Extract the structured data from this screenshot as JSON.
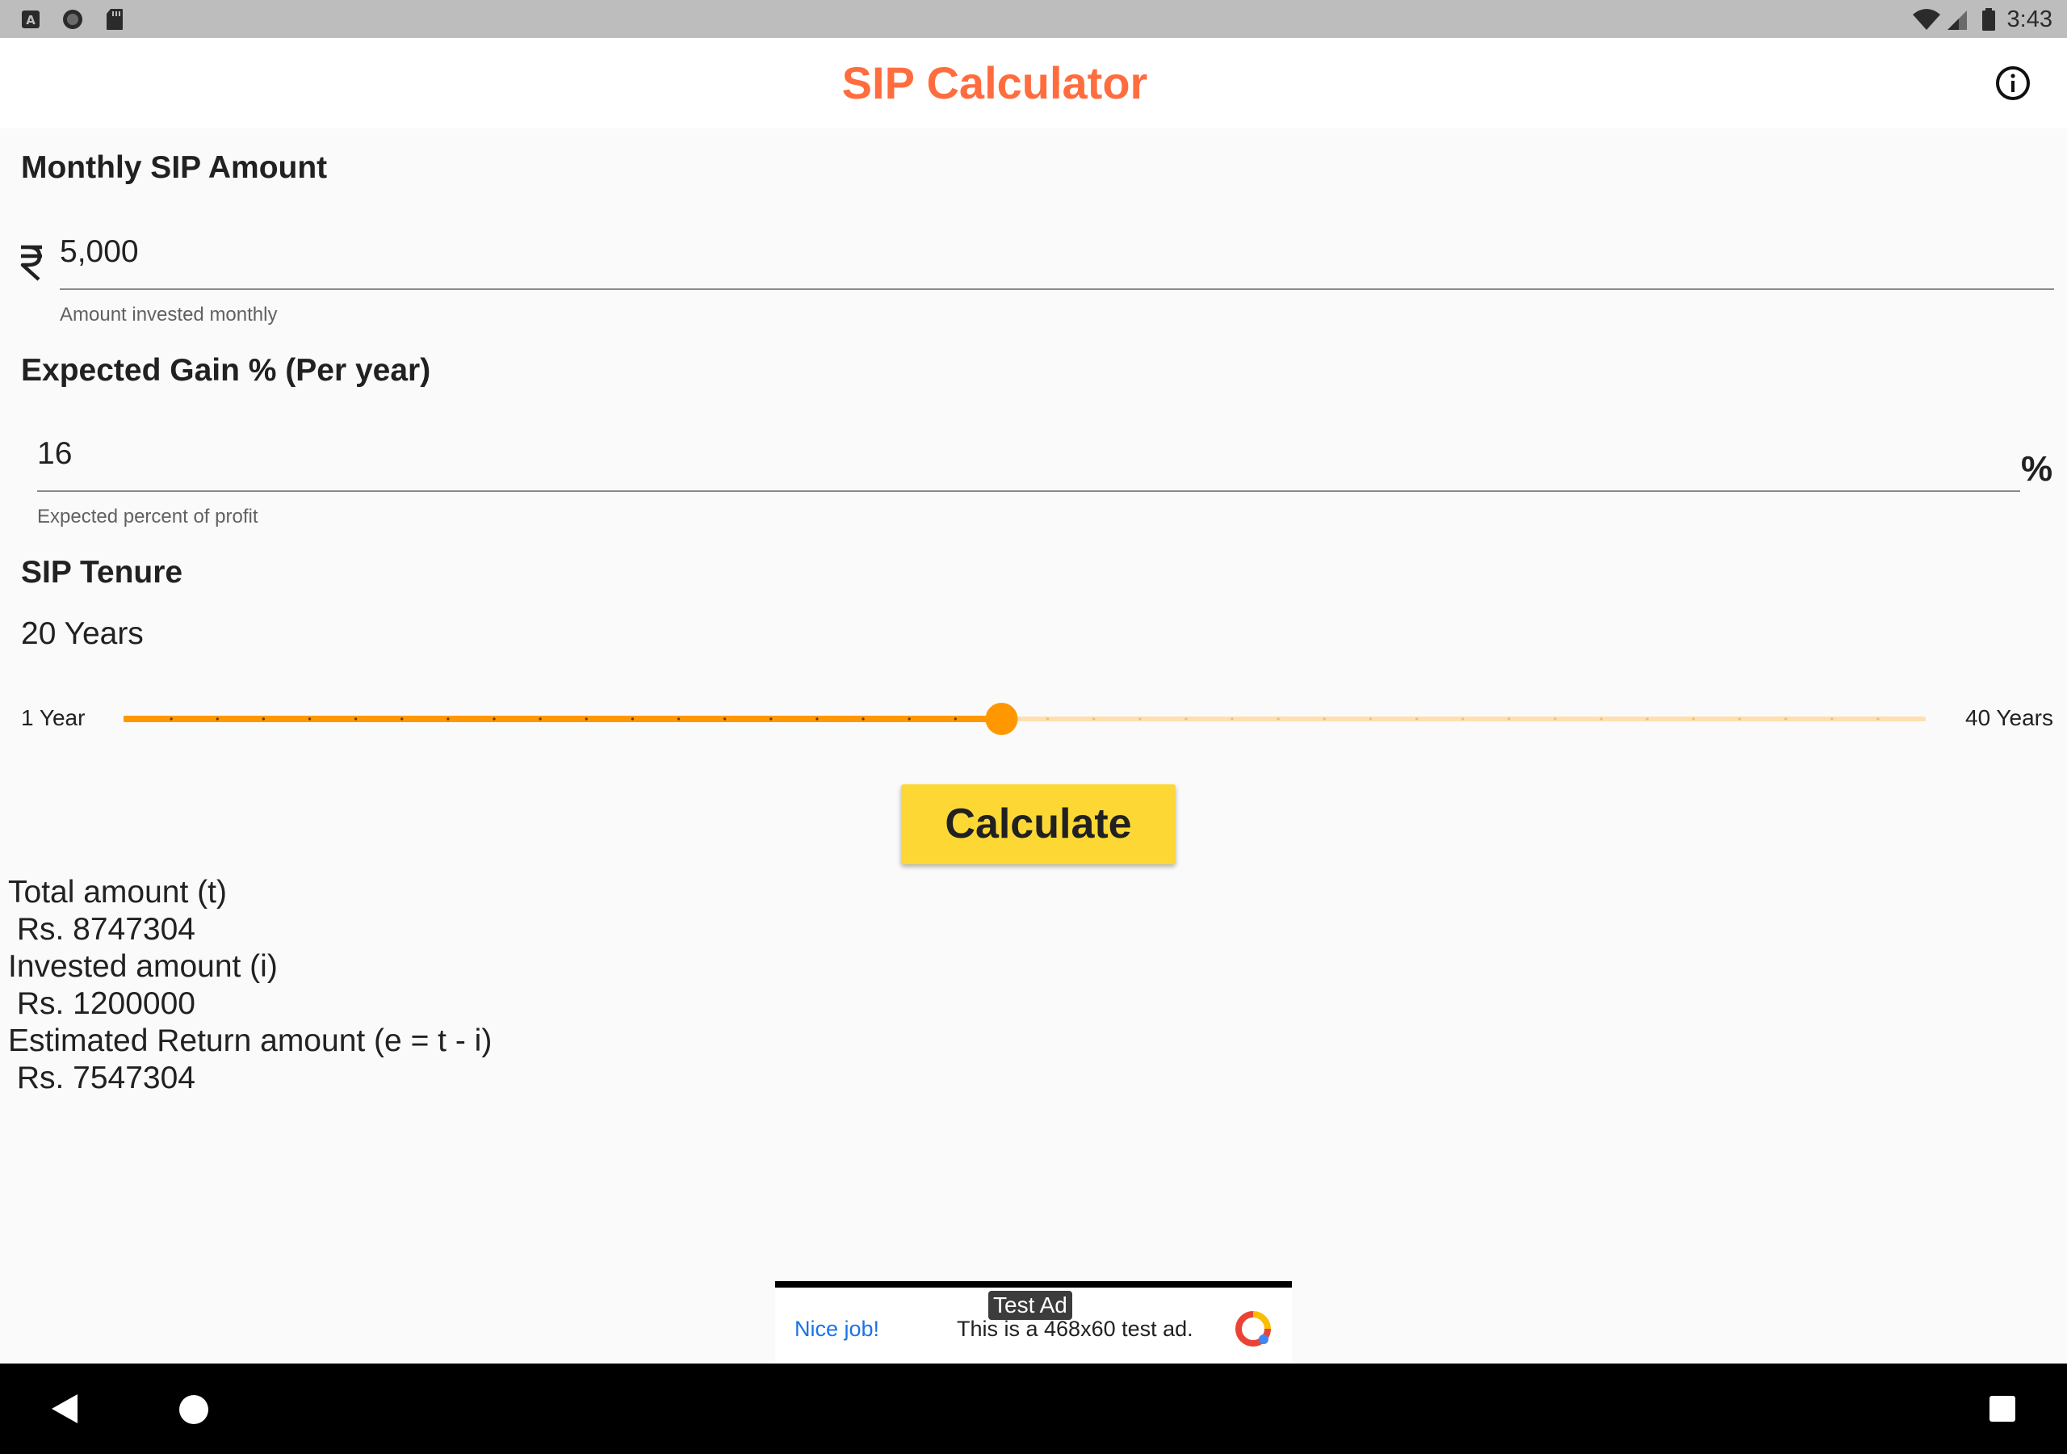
{
  "status_bar": {
    "time": "3:43",
    "left_icons": [
      "text-a-icon",
      "circle-icon",
      "sd-card-icon"
    ],
    "right_icons": [
      "wifi-icon",
      "cell-signal-icon",
      "battery-icon"
    ]
  },
  "app_bar": {
    "title": "SIP Calculator",
    "title_color": "#ff6d3f",
    "info_icon": "info-icon"
  },
  "monthly_sip": {
    "label": "Monthly SIP Amount",
    "currency_icon": "rupee-icon",
    "value": "5,000",
    "helper": "Amount invested monthly"
  },
  "expected_gain": {
    "label": "Expected Gain % (Per year)",
    "value": "16",
    "suffix": "%",
    "helper": "Expected percent of profit"
  },
  "tenure": {
    "label": "SIP Tenure",
    "value_text": "20 Years",
    "slider": {
      "min_label": "1 Year",
      "max_label": "40 Years",
      "min": 1,
      "max": 40,
      "value": 20,
      "active_color": "#ff9800",
      "inactive_color": "#ffe0b2"
    }
  },
  "calculate_button": {
    "label": "Calculate",
    "color": "#fdd835"
  },
  "results": {
    "total_label": "Total amount (t)",
    "total_value": " Rs. 8747304",
    "invested_label": "Invested amount (i)",
    "invested_value": " Rs. 1200000",
    "return_label": "Estimated Return amount (e = t - i)",
    "return_value": " Rs. 7547304"
  },
  "ad": {
    "badge": "Test Ad",
    "headline": "Nice job!",
    "text": "This is a 468x60 test ad.",
    "logo_icon": "ad-logo-icon"
  },
  "nav_bar": {
    "icons": [
      "back-icon",
      "home-icon",
      "recents-icon"
    ]
  }
}
